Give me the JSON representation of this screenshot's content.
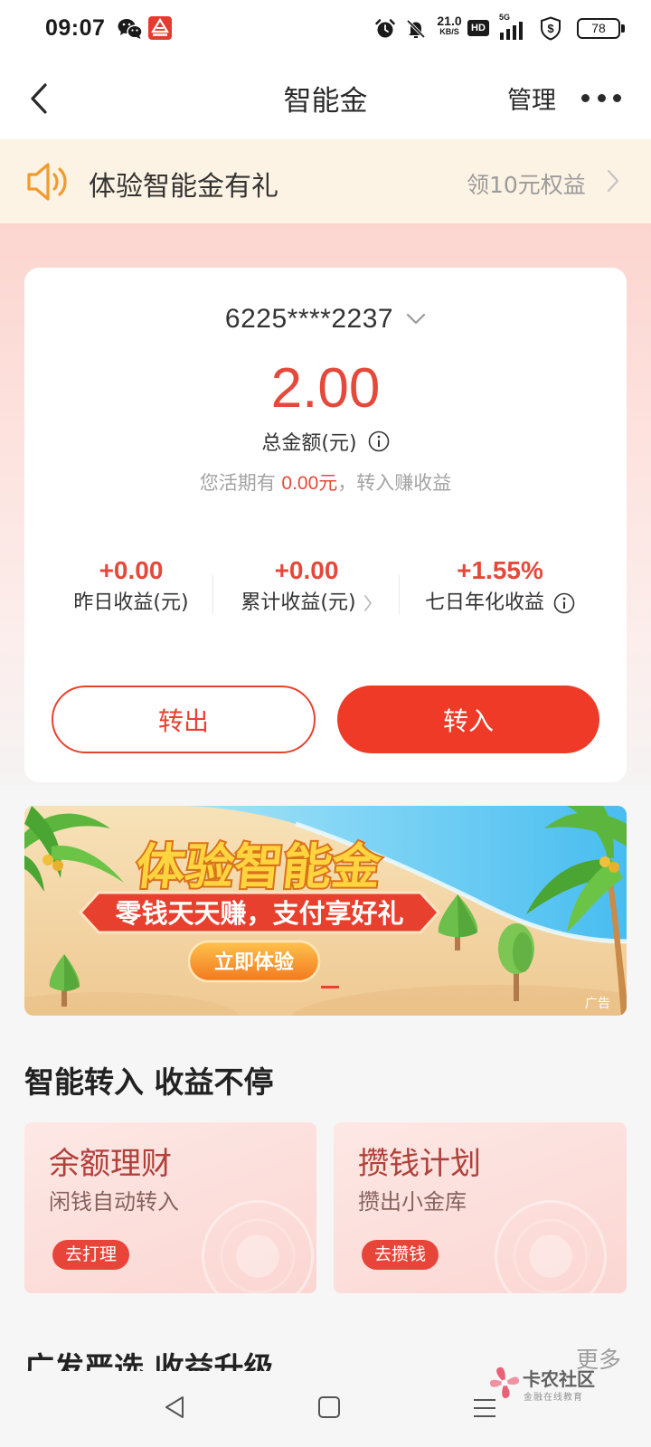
{
  "status_bar": {
    "time": "09:07",
    "speed_value": "21.0",
    "speed_unit": "KB/S",
    "hd_label": "HD",
    "network_label": "5G",
    "battery_level": "78",
    "icons": [
      "wechat-icon",
      "app-icon",
      "alarm-icon",
      "bell-off-icon",
      "signal-icon",
      "shield-icon",
      "battery-icon"
    ]
  },
  "header": {
    "title": "智能金",
    "manage_label": "管理",
    "icons": [
      "back-icon",
      "more-icon"
    ]
  },
  "notice": {
    "text": "体验智能金有礼",
    "link_label": "领10元权益",
    "icons": [
      "speaker-icon",
      "chevron-right-icon"
    ]
  },
  "account": {
    "card_number": "6225****2237",
    "total_amount": "2.00",
    "total_label": "总金额(元)",
    "tip_prefix": "您活期有",
    "tip_amount": "0.00元",
    "tip_suffix": "，转入赚收益"
  },
  "stats": [
    {
      "value": "+0.00",
      "label": "昨日收益(元)"
    },
    {
      "value": "+0.00",
      "label": "累计收益(元)"
    },
    {
      "value": "+1.55%",
      "label": "七日年化收益"
    }
  ],
  "actions": {
    "transfer_out_label": "转出",
    "transfer_in_label": "转入"
  },
  "ad_banner": {
    "headline": "体验智能金",
    "slogan": "零钱天天赚，支付享好礼",
    "cta_label": "立即体验",
    "ad_tag": "广告"
  },
  "smart_section": {
    "title": "智能转入 收益不停",
    "cards": [
      {
        "title": "余额理财",
        "subtitle": "闲钱自动转入",
        "button_label": "去打理"
      },
      {
        "title": "攒钱计划",
        "subtitle": "攒出小金库",
        "button_label": "去攒钱"
      }
    ]
  },
  "selected_section": {
    "title": "广发严选 收益升级",
    "more_label": "更多"
  },
  "watermark": {
    "name": "卡农社区",
    "tagline": "金融在线教育"
  },
  "nav_bar": {
    "icons": [
      "nav-back-icon",
      "nav-home-icon",
      "nav-menu-icon"
    ]
  },
  "colors": {
    "accent": "#ee3a27",
    "amount": "#e5493b",
    "notice_bg": "#fdf3e4",
    "card_title": "#b0403a",
    "page_top_pink": "#fcd5cf"
  }
}
